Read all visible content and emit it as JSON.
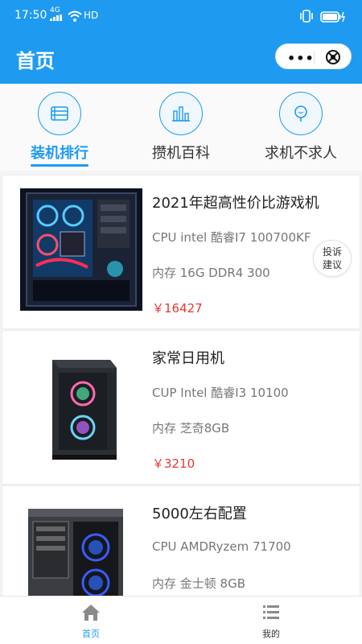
{
  "statusbar": {
    "time": "17:50",
    "network": "4G",
    "hd": "HD"
  },
  "navbar": {
    "title": "首页",
    "more_glyph": "•••"
  },
  "categories": [
    {
      "label": "装机排行",
      "icon": "server-icon",
      "active": true
    },
    {
      "label": "攒机百科",
      "icon": "chart-icon",
      "active": false
    },
    {
      "label": "求机不求人",
      "icon": "bulb-icon",
      "active": false
    }
  ],
  "products": [
    {
      "name": "2021年超高性价比游戏机",
      "cpu": "CPU intel 酷睿I7 100700KF",
      "memory": "内存  16G DDR4 300",
      "price": "￥16427"
    },
    {
      "name": "家常日用机",
      "cpu": "CUP Intel 酷睿I3 10100",
      "memory": "内存 芝奇8GB",
      "price": "￥3210"
    },
    {
      "name": "5000左右配置",
      "cpu": "CPU  AMDRyzem 71700",
      "memory": "内存 金士顿 8GB",
      "price": ""
    }
  ],
  "complaint": {
    "line1": "投诉",
    "line2": "建议"
  },
  "tabbar": [
    {
      "label": "首页",
      "active": true
    },
    {
      "label": "我的",
      "active": false
    }
  ],
  "colors": {
    "primary": "#1e9bf0",
    "price": "#e53935"
  }
}
